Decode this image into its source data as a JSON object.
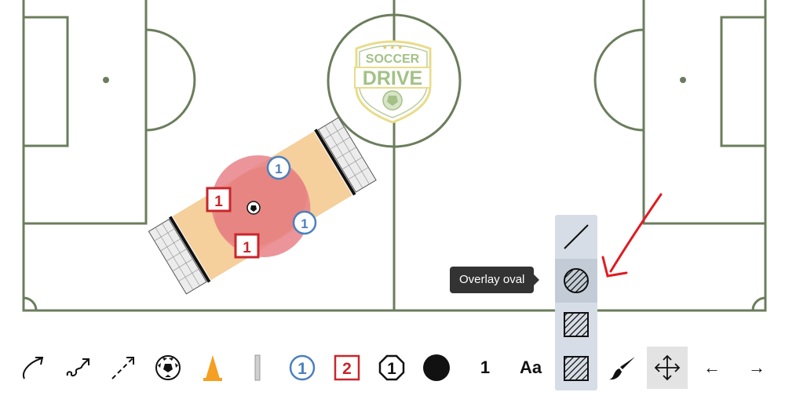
{
  "colors": {
    "pitch_line": "#6b7d5c",
    "drill_area": "#f5d09c",
    "overlay_oval": "#e8828a",
    "player_blue": "#4a80bd",
    "player_red": "#c8262c",
    "cone": "#f5a022",
    "annotation_arrow": "#e11b22",
    "menu_bg": "#d6dde6",
    "tooltip_bg": "#333333"
  },
  "logo": {
    "line1": "SOCCER",
    "line2": "DRIVE"
  },
  "players": {
    "red_1": "1",
    "red_2": "1",
    "blue_1": "1",
    "blue_2": "1"
  },
  "shape_menu": {
    "items": [
      {
        "icon": "line-icon"
      },
      {
        "icon": "overlay-oval-icon"
      },
      {
        "icon": "hatched-rectangle-icon"
      },
      {
        "icon": "hatched-square-icon"
      }
    ],
    "tooltip": "Overlay oval"
  },
  "toolbar": {
    "items": [
      {
        "icon": "curved-arrow-icon"
      },
      {
        "icon": "squiggle-arrow-icon"
      },
      {
        "icon": "dashed-arrow-icon"
      },
      {
        "icon": "soccer-ball-icon"
      },
      {
        "icon": "cone-icon"
      },
      {
        "icon": "pole-icon"
      },
      {
        "icon": "blue-player-icon",
        "label": "1"
      },
      {
        "icon": "red-player-icon",
        "label": "2"
      },
      {
        "icon": "octagon-player-icon",
        "label": "1"
      },
      {
        "icon": "black-dot-icon"
      },
      {
        "icon": "number-tool",
        "label": "1"
      },
      {
        "icon": "text-tool",
        "label": "Aa"
      },
      {
        "icon": "brush-icon"
      },
      {
        "icon": "move-icon"
      },
      {
        "icon": "undo-arrow-icon",
        "label": "←"
      },
      {
        "icon": "redo-arrow-icon",
        "label": "→"
      }
    ]
  }
}
